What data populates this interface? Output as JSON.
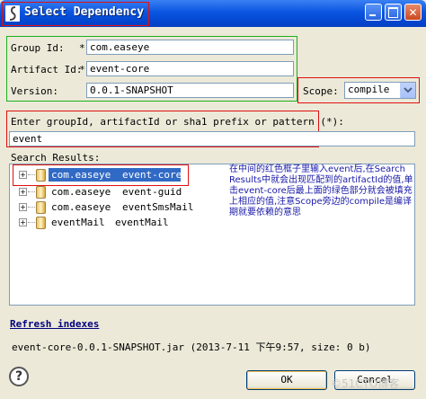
{
  "window": {
    "title": "Select Dependency"
  },
  "form": {
    "group_id_label": "Group Id:",
    "group_id_value": "com.easeye",
    "artifact_id_label": "Artifact Id:",
    "artifact_id_value": "event-core",
    "version_label": "Version:",
    "version_value": "0.0.1-SNAPSHOT",
    "required_marker": "*",
    "scope_label": "Scope:",
    "scope_value": "compile"
  },
  "search": {
    "prompt": "Enter groupId, artifactId or sha1 prefix or pattern (*):",
    "query": "event",
    "results_label": "Search Results:",
    "results": [
      {
        "group": "com.easeye",
        "artifact": "event-core",
        "selected": true
      },
      {
        "group": "com.easeye",
        "artifact": "event-guid",
        "selected": false
      },
      {
        "group": "com.easeye",
        "artifact": "eventSmsMail",
        "selected": false
      },
      {
        "group": "eventMail",
        "artifact": "eventMail",
        "selected": false
      }
    ],
    "annotation": "在中间的红色框子里输入event后,在Search Results中就会出现匹配到的artifactId的值,单击event-core后最上面的绿色部分就会被填充上相应的值,注意Scope旁边的compile是编译期就要依赖的意思"
  },
  "footer": {
    "refresh_link": "Refresh indexes",
    "artifact_info": "event-core-0.0.1-SNAPSHOT.jar (2013-7-11 下午9:57, size: 0 b)",
    "ok_label": "OK",
    "cancel_label": "Cancel",
    "watermark": "©51CTO博客"
  },
  "icons": [
    "app-icon",
    "minimize-icon",
    "maximize-icon",
    "close-icon",
    "jar-icon",
    "expand-icon",
    "help-icon",
    "chevron-down-icon"
  ]
}
